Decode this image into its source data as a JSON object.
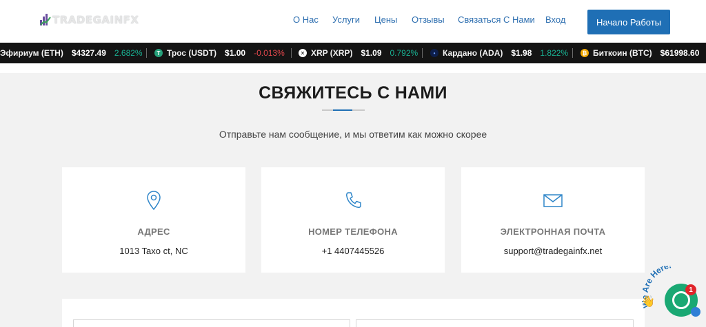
{
  "header": {
    "logo_text": "TRADEGAINFX",
    "nav": [
      {
        "label": "О Нас"
      },
      {
        "label": "Услуги"
      },
      {
        "label": "Цены"
      },
      {
        "label": "Отзывы"
      },
      {
        "label": "Связаться С Нами"
      },
      {
        "label": "Вход"
      }
    ],
    "cta_label": "Начало Работы"
  },
  "ticker": [
    {
      "name": "Эфириум (ETH)",
      "price": "$4327.49",
      "change": "2.682%",
      "trend": "up",
      "icon": "ethereum-icon"
    },
    {
      "name": "Трос (USDT)",
      "price": "$1.00",
      "change": "-0.013%",
      "trend": "down",
      "icon": "tether-icon",
      "icon_glyph": "T",
      "icon_color": "#26a17b"
    },
    {
      "name": "XRP (XRP)",
      "price": "$1.09",
      "change": "0.792%",
      "trend": "up",
      "icon": "xrp-icon",
      "icon_glyph": "✕",
      "icon_color": "#3a3a3a"
    },
    {
      "name": "Кардано (ADA)",
      "price": "$1.98",
      "change": "1.822%",
      "trend": "up",
      "icon": "cardano-icon",
      "icon_glyph": "•",
      "icon_color": "#0d1e4a"
    },
    {
      "name": "Биткоин (BTC)",
      "price": "$61998.60",
      "change": "",
      "trend": "up",
      "icon": "bitcoin-icon",
      "icon_glyph": "₿",
      "icon_color": "#f2a900"
    }
  ],
  "section": {
    "title": "СВЯЖИТЕСЬ С НАМИ",
    "subtitle": "Отправьте нам сообщение, и мы ответим как можно скорее"
  },
  "cards": [
    {
      "label": "АДРЕС",
      "value": "1013 Taxo ct, NC",
      "icon": "location-pin-icon"
    },
    {
      "label": "НОМЕР ТЕЛЕФОНА",
      "value": "+1 4407445526",
      "icon": "phone-icon"
    },
    {
      "label": "ЭЛЕКТРОННАЯ ПОЧТА",
      "value": "support@tradegainfx.net",
      "icon": "envelope-icon"
    }
  ],
  "chat": {
    "badge": "1",
    "tagline": "We Are Here!",
    "icon": "chat-bubble-icon"
  },
  "colors": {
    "accent": "#1f6fb5",
    "up": "#19b394",
    "down": "#e5484d",
    "chat": "#1aa873"
  }
}
